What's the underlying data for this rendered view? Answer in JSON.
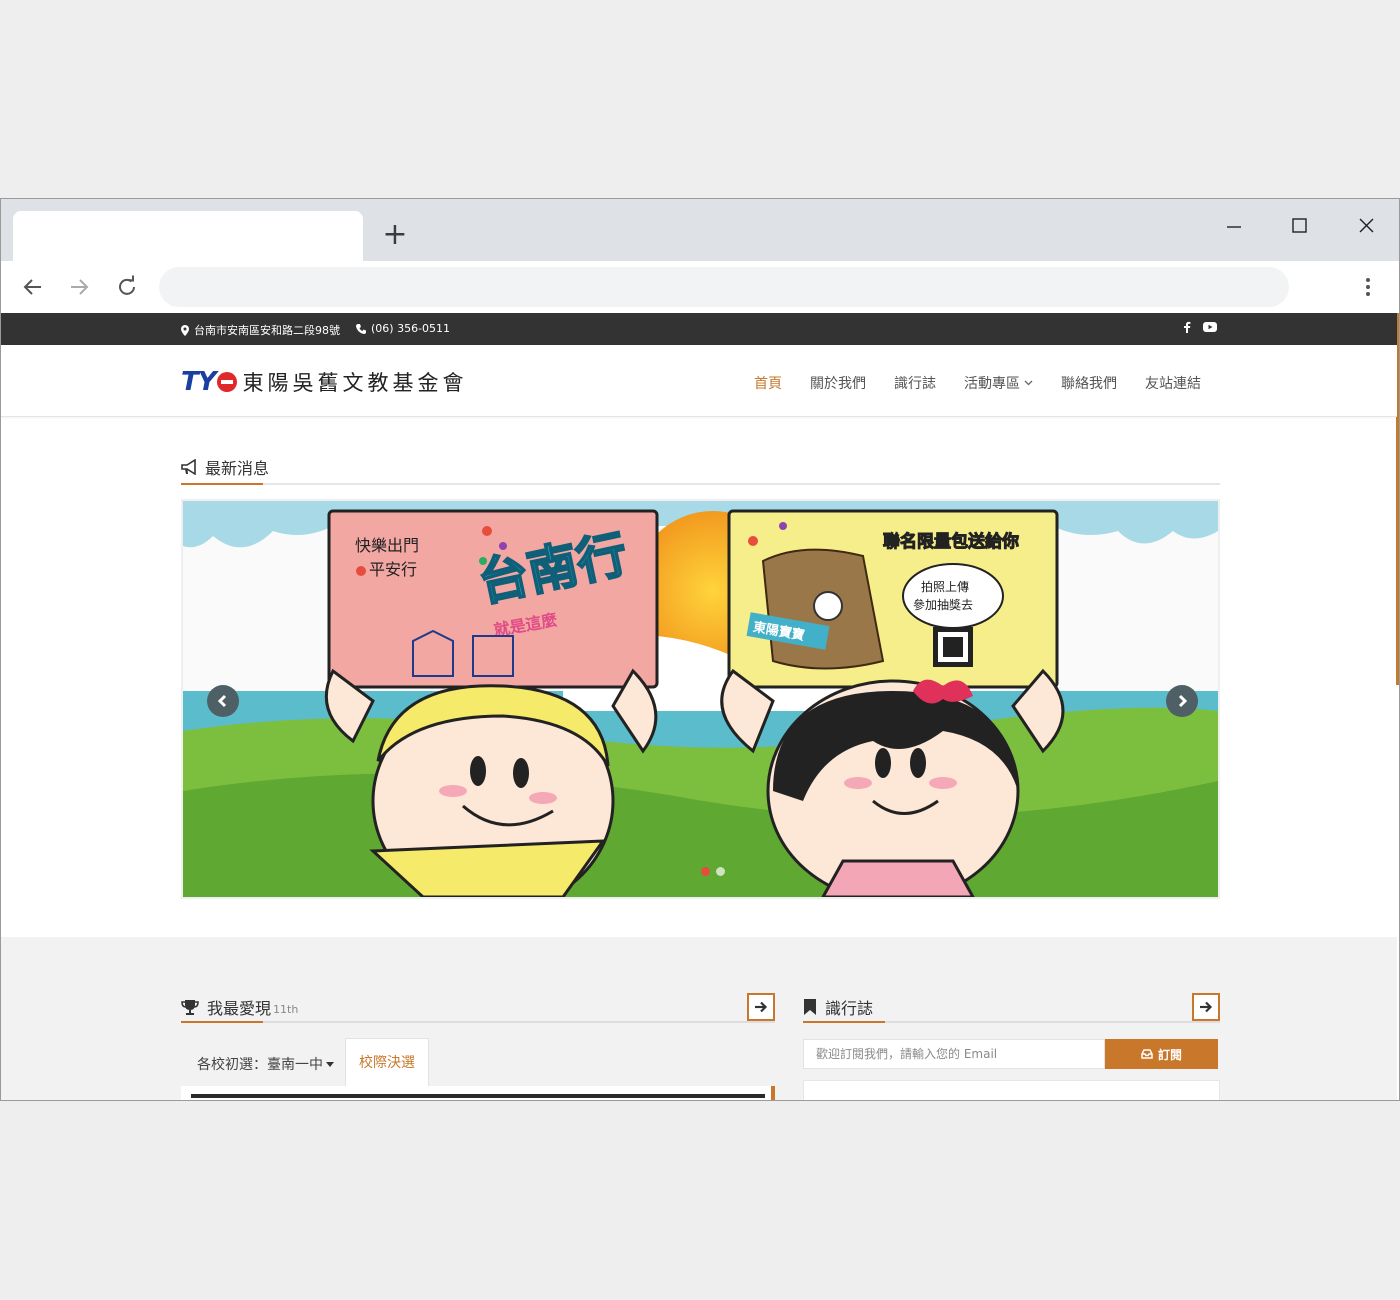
{
  "browser": {
    "new_tab_symbol": "+",
    "minimize_symbol": "—",
    "window_icons": [
      "back-arrow-icon",
      "forward-arrow-icon",
      "reload-icon",
      "kebab-menu-icon",
      "minimize-icon",
      "maximize-icon",
      "close-icon"
    ]
  },
  "topbar": {
    "address": "台南市安南區安和路二段98號",
    "phone": "(06) 356-0511",
    "social": [
      "facebook-icon",
      "youtube-icon"
    ]
  },
  "header": {
    "logo_mark": "TY",
    "org_name": "東陽吳舊文教基金會",
    "nav": [
      {
        "label": "首頁",
        "active": true
      },
      {
        "label": "關於我們"
      },
      {
        "label": "識行誌"
      },
      {
        "label": "活動專區"
      },
      {
        "label": "聯絡我們"
      },
      {
        "label": "友站連結"
      }
    ]
  },
  "news": {
    "title": "最新消息"
  },
  "slider": {
    "left_sign_text_1": "快樂出門",
    "left_sign_text_2": "平安行",
    "left_sign_title": "台南行",
    "left_sign_sub": "就是這麼",
    "right_sign_title": "聯名限量包送給你",
    "right_sign_bubble_1": "拍照上傳",
    "right_sign_bubble_2": "參加抽獎去",
    "right_sign_tag": "東陽寶寶",
    "dots_total": 2,
    "dots_active": 0
  },
  "favorites": {
    "title": "我最愛現",
    "suffix": "11th",
    "tabs": [
      {
        "label": "各校初選：臺南一中"
      },
      {
        "label": "校際決選",
        "active": true
      }
    ]
  },
  "journal": {
    "title": "識行誌",
    "subscribe_placeholder": "歡迎訂閱我們，請輸入您的 Email",
    "subscribe_button": "訂閱"
  },
  "colors": {
    "accent": "#c9772a",
    "topbar_bg": "#333333",
    "logo_blue": "#1a3fa0",
    "logo_red": "#e0272a"
  }
}
